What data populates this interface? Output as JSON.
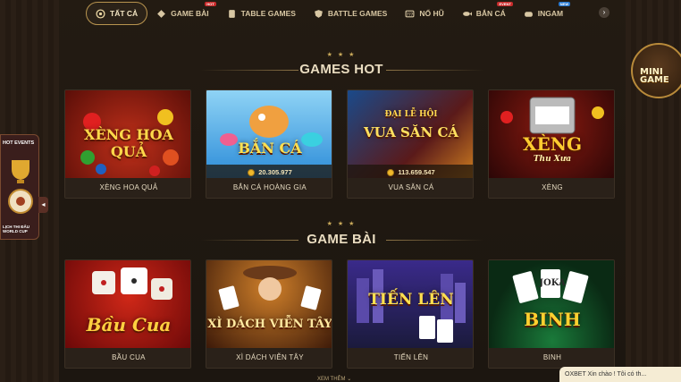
{
  "nav": {
    "items": [
      {
        "label": "TẤT CẢ",
        "icon": "all-games-icon",
        "active": true
      },
      {
        "label": "GAME BÀI",
        "icon": "cards-icon",
        "badge": "HOT"
      },
      {
        "label": "TABLE GAMES",
        "icon": "table-icon"
      },
      {
        "label": "BATTLE GAMES",
        "icon": "shield-icon"
      },
      {
        "label": "NỔ HŨ",
        "icon": "slot-icon"
      },
      {
        "label": "BẮN CÁ",
        "icon": "fish-icon",
        "badge": "EVENT"
      },
      {
        "label": "INGAM",
        "icon": "controller-icon",
        "badge": "NEW"
      }
    ]
  },
  "hot_section": {
    "stars": "★ ★ ★",
    "title": "GAMES HOT",
    "games": [
      {
        "art_title": "XÈNG HOA QUẢ",
        "label": "XÈNG HOA QUẢ",
        "colors": [
          "#7a1a0e",
          "#c0301a"
        ]
      },
      {
        "art_title": "BẮN CÁ",
        "label": "BẮN CÁ HOÀNG GIA",
        "jackpot": "20.305.977",
        "colors": [
          "#2a8bd8",
          "#8fd3f5"
        ]
      },
      {
        "art_title": "VUA SĂN CÁ",
        "art_subtitle": "ĐẠI LỄ HỘI",
        "label": "VUA SĂN CÁ",
        "jackpot": "113.659.547",
        "colors": [
          "#5a1a1a",
          "#1a4a8a"
        ]
      },
      {
        "art_title": "XÈNG",
        "art_subtitle": "Thu Xưa",
        "label": "XÈNG",
        "colors": [
          "#3a0808",
          "#8a1a10"
        ]
      }
    ]
  },
  "cards_section": {
    "stars": "★ ★ ★",
    "title": "GAME BÀI",
    "games": [
      {
        "art_title": "Bầu Cua",
        "label": "BẦU CUA",
        "colors": [
          "#8a1010",
          "#d02818"
        ]
      },
      {
        "art_title": "XÌ DÁCH VIỄN TÂY",
        "label": "XÌ DÁCH VIỄN TÂY",
        "colors": [
          "#3a1808",
          "#c0782a"
        ]
      },
      {
        "art_title": "TIẾN LÊN",
        "label": "TIẾN LÊN",
        "colors": [
          "#1a1a5a",
          "#6a2a9a"
        ]
      },
      {
        "art_title": "BINH",
        "art_subtitle": "JOKA",
        "label": "BINH",
        "colors": [
          "#0a3a1a",
          "#1a7a3a"
        ]
      }
    ]
  },
  "hot_events": {
    "label": "HOT EVENTS",
    "caption": "LỊCH THI ĐẤU WORLD CUP"
  },
  "mini_game": {
    "label": "MINI GAME"
  },
  "chat": {
    "text": "OXBET Xin chào ! Tôi có th..."
  },
  "more_link": "XEM THÊM ⌄"
}
